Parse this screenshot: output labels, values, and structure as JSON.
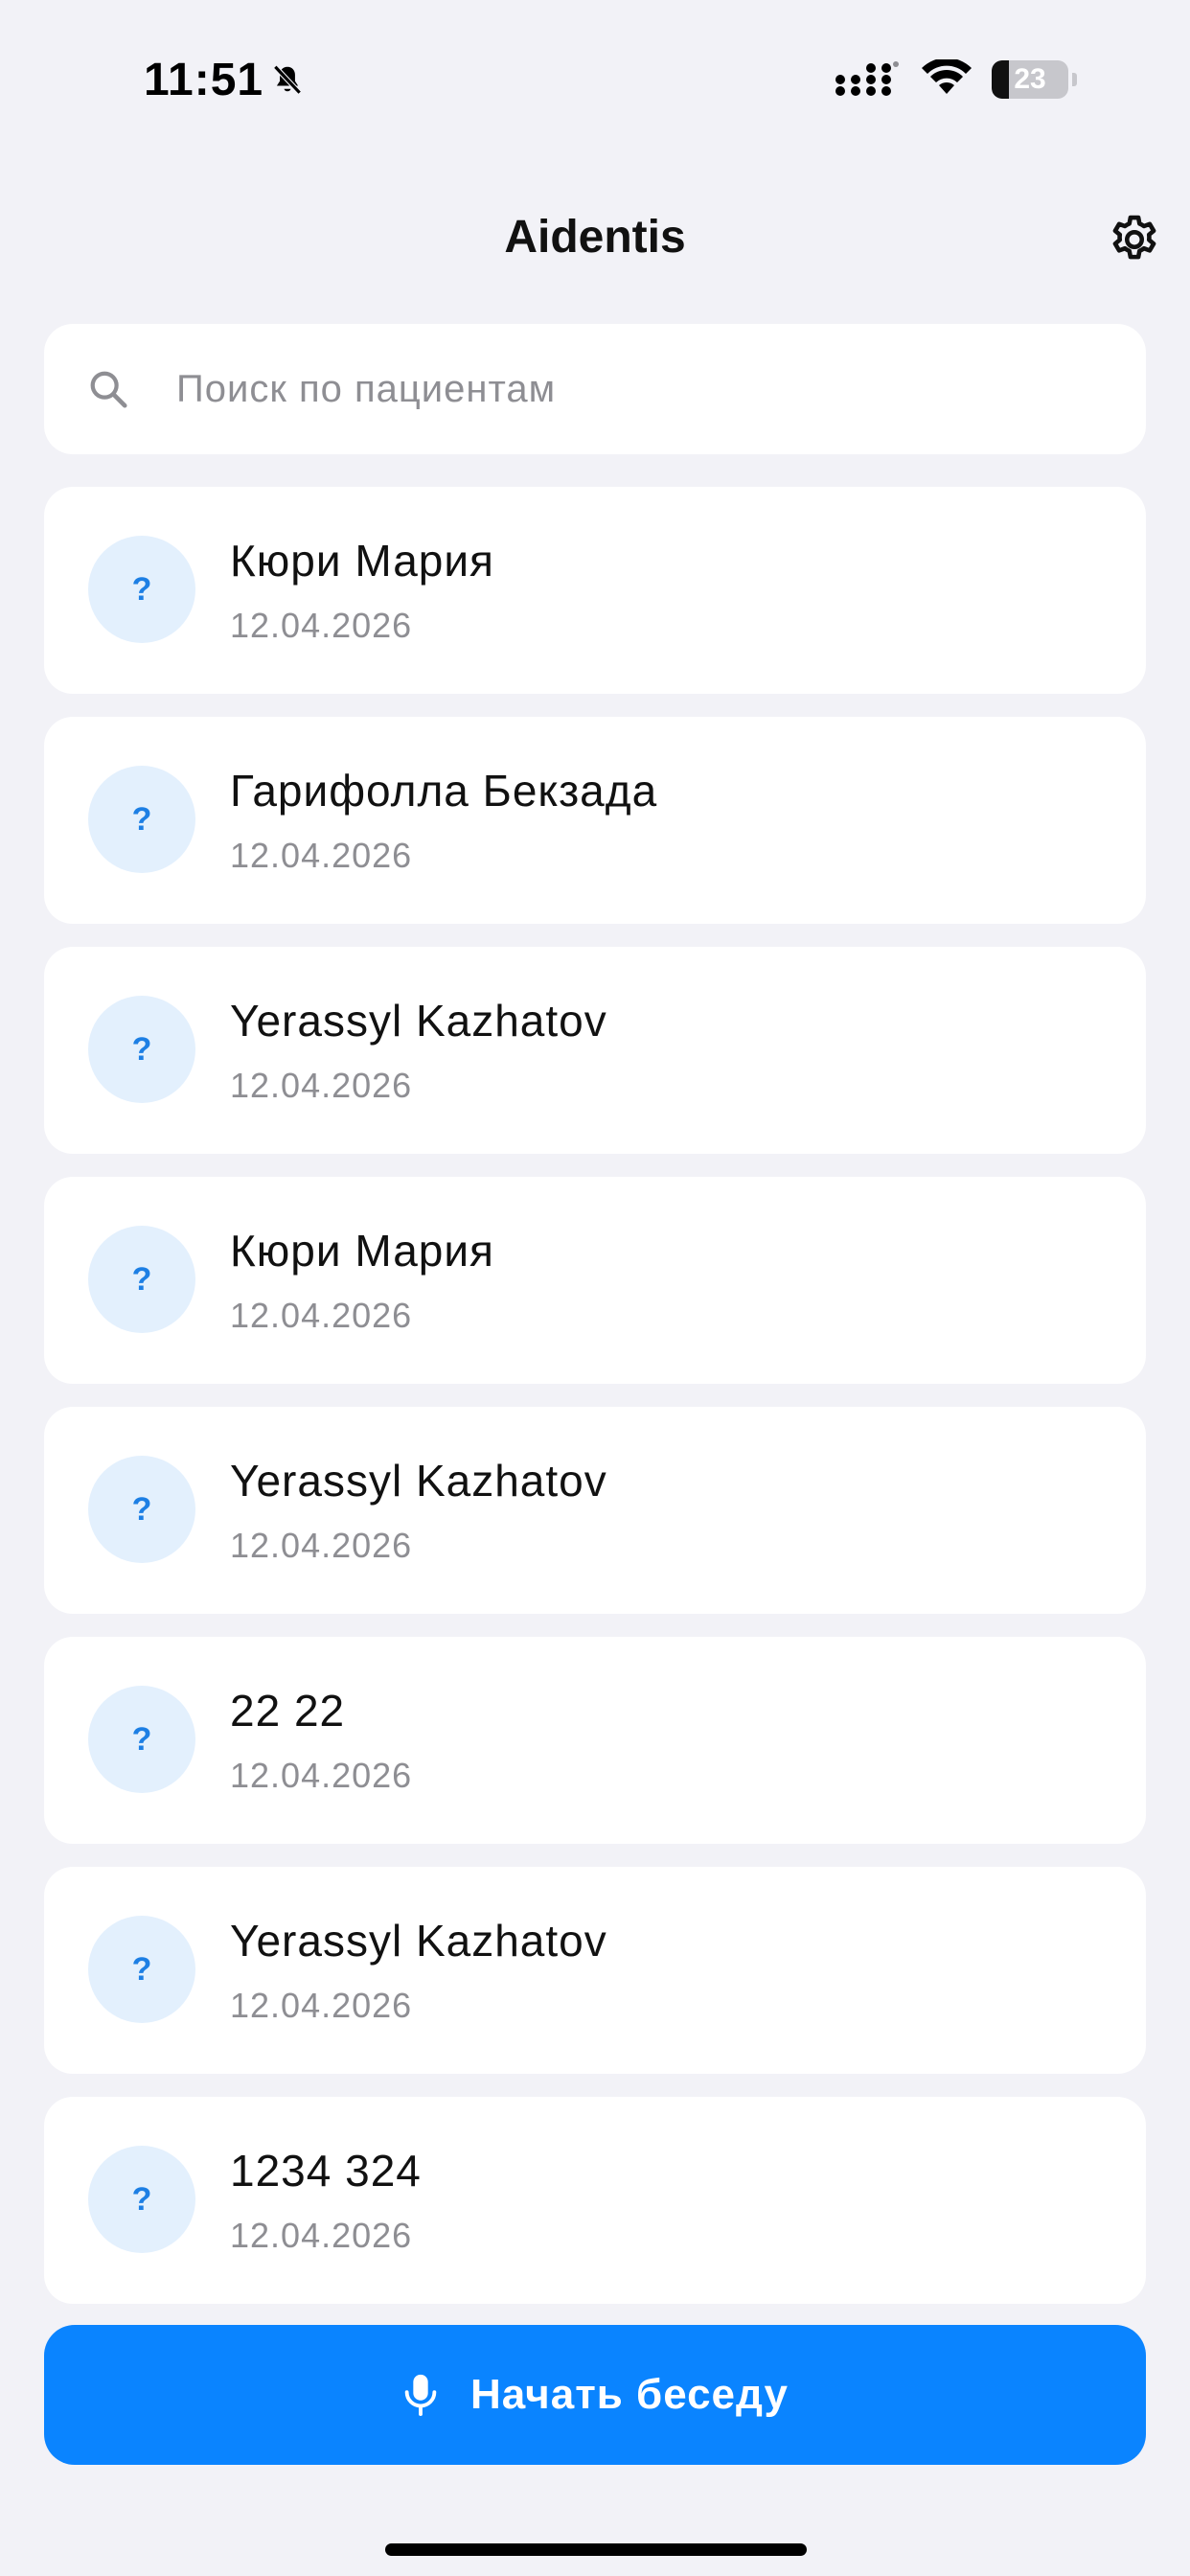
{
  "status_bar": {
    "time": "11:51",
    "battery": "23",
    "battery_level": 0.23
  },
  "header": {
    "title": "Aidentis"
  },
  "search": {
    "placeholder": "Поиск по пациентам",
    "value": ""
  },
  "patients": [
    {
      "avatar": "?",
      "name": "Кюри Мария",
      "date": "12.04.2026"
    },
    {
      "avatar": "?",
      "name": "Гарифолла Бекзада",
      "date": "12.04.2026"
    },
    {
      "avatar": "?",
      "name": "Yerassyl Kazhatov",
      "date": "12.04.2026"
    },
    {
      "avatar": "?",
      "name": "Кюри Мария",
      "date": "12.04.2026"
    },
    {
      "avatar": "?",
      "name": "Yerassyl Kazhatov",
      "date": "12.04.2026"
    },
    {
      "avatar": "?",
      "name": "22 22",
      "date": "12.04.2026"
    },
    {
      "avatar": "?",
      "name": "Yerassyl Kazhatov",
      "date": "12.04.2026"
    },
    {
      "avatar": "?",
      "name": "1234 324",
      "date": "12.04.2026"
    }
  ],
  "actions": {
    "start_label": "Начать беседу"
  },
  "colors": {
    "background": "#f2f2f7",
    "accent": "#0a84ff",
    "avatar_bg": "#e3f0fd",
    "avatar_fg": "#1d7fe4",
    "secondary_text": "#8e8e93"
  },
  "icons": {
    "notification": "bell-slash-icon",
    "signal": "cellular-signal-icon",
    "wifi": "wifi-icon",
    "settings": "gear-icon",
    "search": "search-icon",
    "microphone": "microphone-icon"
  }
}
